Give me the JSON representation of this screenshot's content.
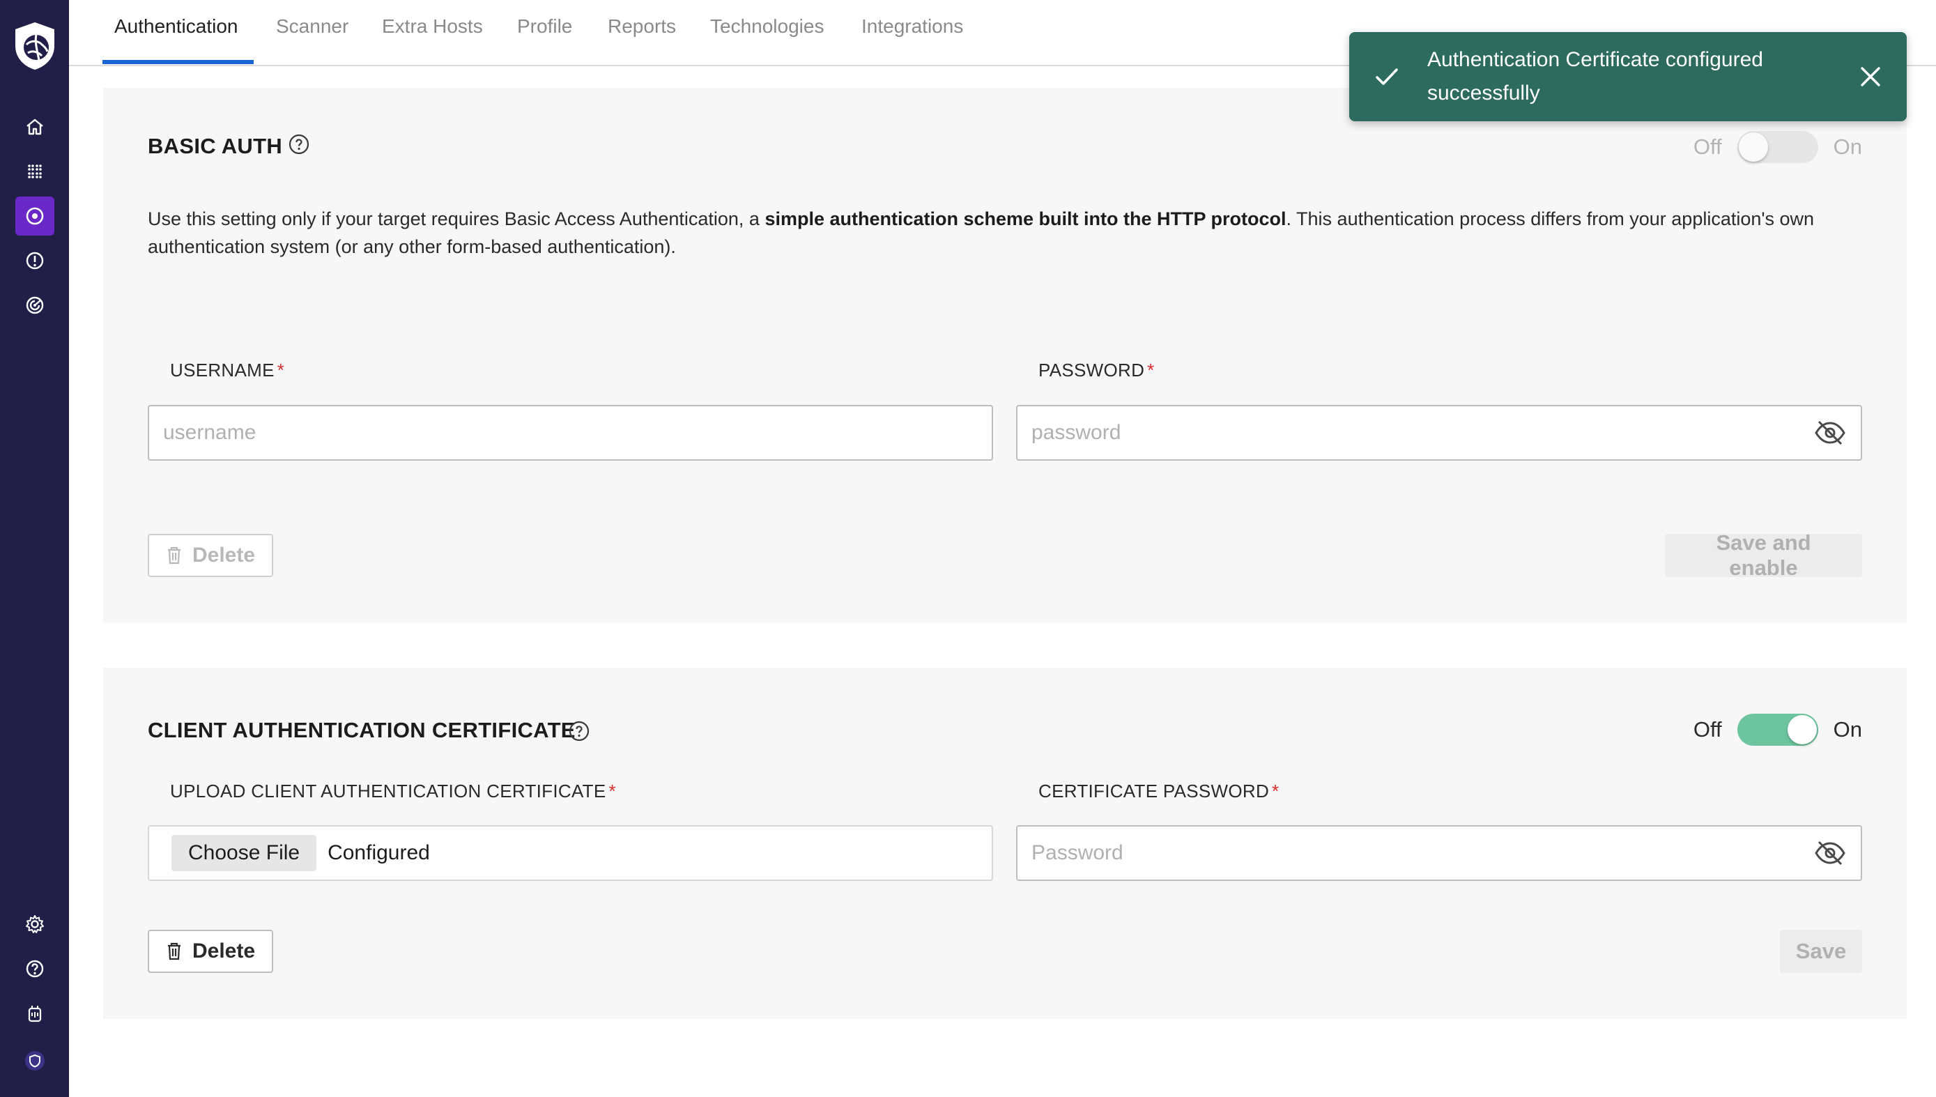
{
  "tabs": [
    {
      "label": "Authentication"
    },
    {
      "label": "Scanner"
    },
    {
      "label": "Extra Hosts"
    },
    {
      "label": "Profile"
    },
    {
      "label": "Reports"
    },
    {
      "label": "Technologies"
    },
    {
      "label": "Integrations"
    }
  ],
  "active_tab": "Authentication",
  "toast": {
    "message": "Authentication Certificate configured successfully",
    "color": "#2c6b5e"
  },
  "basic_auth": {
    "title": "BASIC AUTH",
    "toggle": {
      "off_label": "Off",
      "on_label": "On",
      "state": "off",
      "disabled": true
    },
    "description_pre": "Use this setting only if your target requires Basic Access Authentication, a ",
    "description_bold": "simple authentication scheme built into the HTTP protocol",
    "description_post": ". This authentication process differs from your application's own authentication system (or any other form-based authentication).",
    "username_label": "USERNAME",
    "username_placeholder": "username",
    "username_value": "",
    "password_label": "PASSWORD",
    "password_placeholder": "password",
    "password_value": "",
    "required_mark": "*",
    "delete_label": "Delete",
    "save_label": "Save and enable"
  },
  "client_cert": {
    "title": "CLIENT AUTHENTICATION CERTIFICATE",
    "toggle": {
      "off_label": "Off",
      "on_label": "On",
      "state": "on",
      "disabled": false,
      "color": "#6cc59e"
    },
    "upload_label": "UPLOAD CLIENT AUTHENTICATION CERTIFICATE",
    "choose_file_label": "Choose File",
    "file_status": "Configured",
    "password_label": "CERTIFICATE PASSWORD",
    "password_placeholder": "Password",
    "password_value": "",
    "required_mark": "*",
    "delete_label": "Delete",
    "save_label": "Save"
  },
  "sidebar": {
    "items": [
      {
        "icon": "home-icon"
      },
      {
        "icon": "grid-icon"
      },
      {
        "icon": "target-icon",
        "active": true
      },
      {
        "icon": "alert-icon"
      },
      {
        "icon": "radar-icon"
      }
    ],
    "bottom_items": [
      {
        "icon": "gear-icon"
      },
      {
        "icon": "help-icon"
      },
      {
        "icon": "robot-icon"
      },
      {
        "icon": "shield-icon"
      }
    ],
    "bg_color": "#211f47",
    "active_color": "#6a28c8"
  }
}
